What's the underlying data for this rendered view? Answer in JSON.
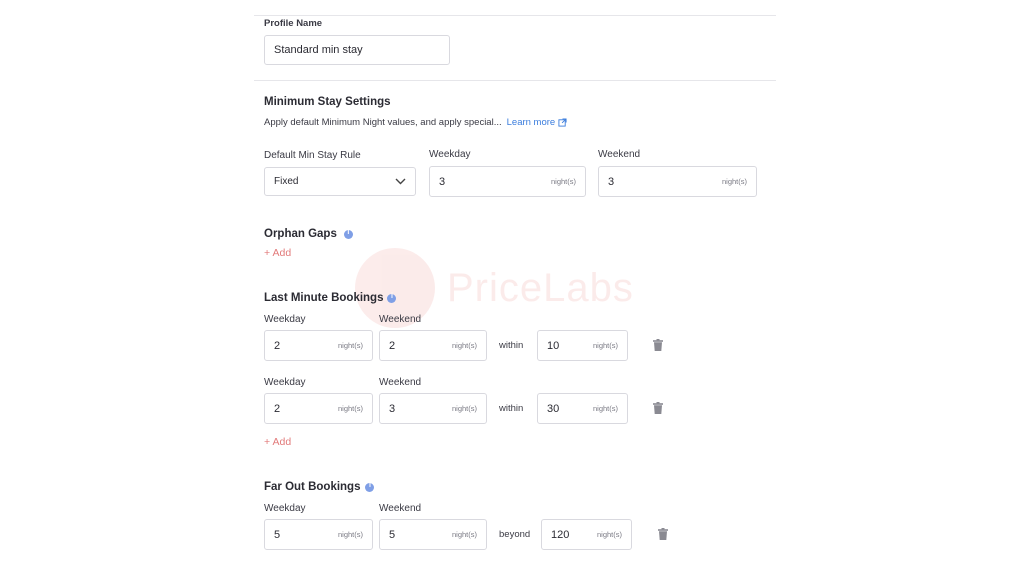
{
  "profile": {
    "label": "Profile Name",
    "value": "Standard min stay"
  },
  "min_stay": {
    "title": "Minimum Stay Settings",
    "description": "Apply default Minimum Night values, and apply special...",
    "learn_more": "Learn more",
    "rule_label": "Default Min Stay Rule",
    "rule_value": "Fixed",
    "weekday_label": "Weekday",
    "weekday_value": "3",
    "weekend_label": "Weekend",
    "weekend_value": "3",
    "unit": "night(s)"
  },
  "orphan_gaps": {
    "title": "Orphan Gaps",
    "add": "+ Add"
  },
  "last_minute": {
    "title": "Last Minute Bookings",
    "rows": [
      {
        "weekday_label": "Weekday",
        "weekday": "2",
        "weekend_label": "Weekend",
        "weekend": "2",
        "connector": "within",
        "days": "10"
      },
      {
        "weekday_label": "Weekday",
        "weekday": "2",
        "weekend_label": "Weekend",
        "weekend": "3",
        "connector": "within",
        "days": "30"
      }
    ],
    "unit": "night(s)",
    "add": "+ Add"
  },
  "far_out": {
    "title": "Far Out Bookings",
    "weekday_label": "Weekday",
    "weekday": "5",
    "weekend_label": "Weekend",
    "weekend": "5",
    "connector": "beyond",
    "days": "120",
    "unit": "night(s)"
  },
  "watermark": {
    "brand": "PriceLabs"
  },
  "icons": {
    "info": "info-icon",
    "trash": "trash-icon",
    "chevron": "chevron-down-icon",
    "external": "external-link-icon"
  },
  "colors": {
    "link": "#3b7ddd",
    "add": "#e27a7a",
    "info": "#7f9fe6",
    "border": "#d9d9df"
  }
}
